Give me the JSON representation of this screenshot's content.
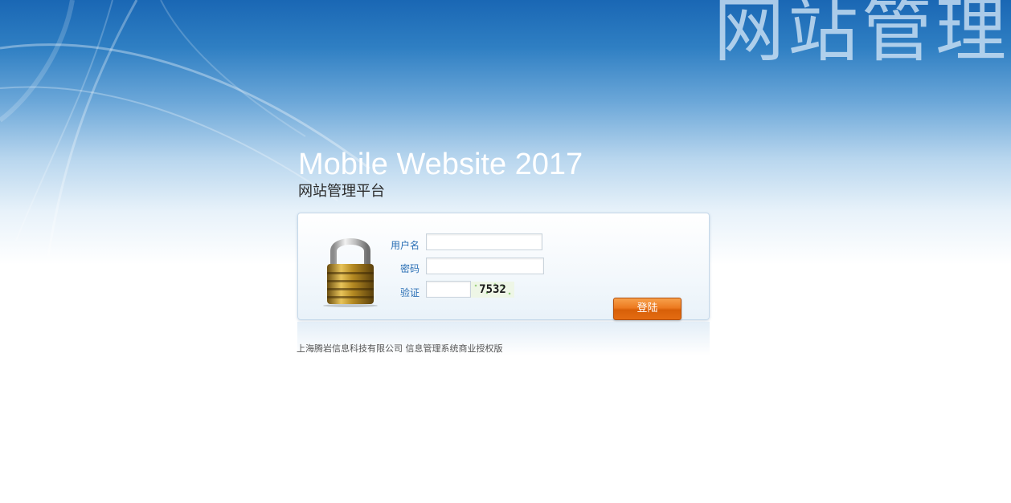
{
  "header": {
    "watermark_text": "网站管理",
    "title_en": "Mobile Website 2017",
    "title_cn": "网站管理平台"
  },
  "login_form": {
    "username_label": "用户名",
    "username_value": "",
    "password_label": "密码",
    "password_value": "",
    "captcha_label": "验证",
    "captcha_value": "",
    "captcha_code": "7532",
    "submit_label": "登陆"
  },
  "footer": {
    "copyright": "上海腾岩信息科技有限公司 信息管理系统商业授权版"
  },
  "icons": {
    "lock": "padlock-icon"
  },
  "colors": {
    "header_blue": "#1a67b4",
    "label_blue": "#2a6fb5",
    "button_orange": "#ec7a1f"
  }
}
